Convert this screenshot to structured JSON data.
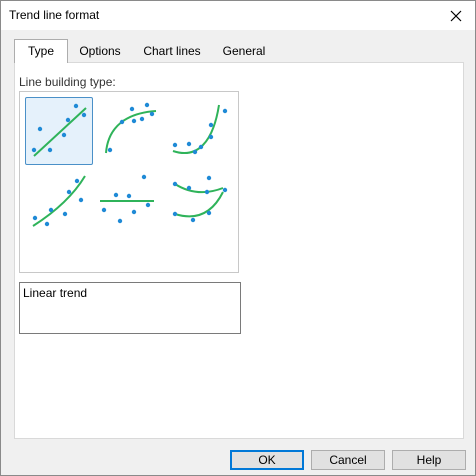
{
  "window": {
    "title": "Trend line format"
  },
  "tabs": [
    {
      "label": "Type"
    },
    {
      "label": "Options"
    },
    {
      "label": "Chart lines"
    },
    {
      "label": "General"
    }
  ],
  "type_tab": {
    "group_label": "Line building type:",
    "options": [
      {
        "name": "linear",
        "icon": "linear-trend-icon",
        "selected": true
      },
      {
        "name": "logarithmic",
        "icon": "logarithmic-trend-icon",
        "selected": false
      },
      {
        "name": "exponential",
        "icon": "exponential-trend-icon",
        "selected": false
      },
      {
        "name": "power",
        "icon": "power-trend-icon",
        "selected": false
      },
      {
        "name": "moving-average",
        "icon": "moving-average-trend-icon",
        "selected": false
      },
      {
        "name": "polynomial",
        "icon": "polynomial-trend-icon",
        "selected": false
      }
    ],
    "description": "Linear trend"
  },
  "buttons": {
    "ok": "OK",
    "cancel": "Cancel",
    "help": "Help"
  },
  "colors": {
    "accent": "#0078d7",
    "line": "#2fb35a",
    "dot": "#1f8ad6",
    "selected_bg": "#e5f1fb"
  }
}
